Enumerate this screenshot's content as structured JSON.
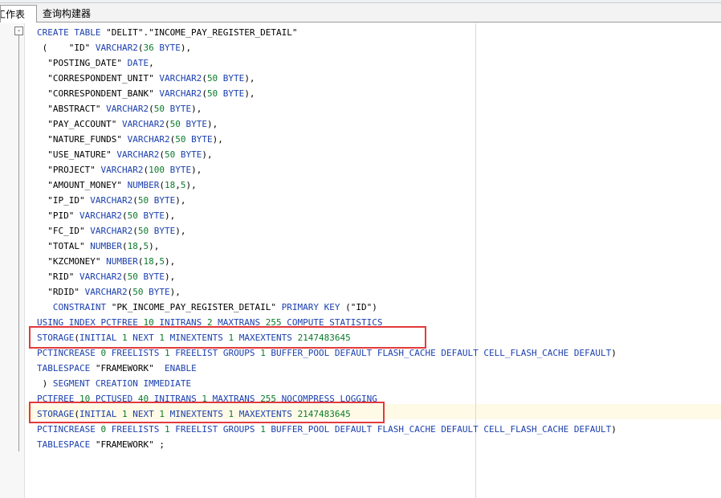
{
  "tabs": [
    {
      "label": "工作表"
    },
    {
      "label": "查询构建器"
    }
  ],
  "fold_symbol": "-",
  "code_lines": [
    [
      {
        "t": "CREATE TABLE ",
        "c": "kw"
      },
      {
        "t": "\"DELIT\".\"INCOME_PAY_REGISTER_DETAIL\"",
        "c": "str"
      }
    ],
    [
      {
        "t": " (    ",
        "c": "str"
      },
      {
        "t": "\"ID\" ",
        "c": "str"
      },
      {
        "t": "VARCHAR2",
        "c": "kw"
      },
      {
        "t": "(",
        "c": "str"
      },
      {
        "t": "36",
        "c": "num"
      },
      {
        "t": " BYTE",
        "c": "kw"
      },
      {
        "t": "),",
        "c": "str"
      }
    ],
    [
      {
        "t": "  \"POSTING_DATE\" ",
        "c": "str"
      },
      {
        "t": "DATE",
        "c": "kw"
      },
      {
        "t": ",",
        "c": "str"
      }
    ],
    [
      {
        "t": "  \"CORRESPONDENT_UNIT\" ",
        "c": "str"
      },
      {
        "t": "VARCHAR2",
        "c": "kw"
      },
      {
        "t": "(",
        "c": "str"
      },
      {
        "t": "50",
        "c": "num"
      },
      {
        "t": " BYTE",
        "c": "kw"
      },
      {
        "t": "),",
        "c": "str"
      }
    ],
    [
      {
        "t": "  \"CORRESPONDENT_BANK\" ",
        "c": "str"
      },
      {
        "t": "VARCHAR2",
        "c": "kw"
      },
      {
        "t": "(",
        "c": "str"
      },
      {
        "t": "50",
        "c": "num"
      },
      {
        "t": " BYTE",
        "c": "kw"
      },
      {
        "t": "),",
        "c": "str"
      }
    ],
    [
      {
        "t": "  \"ABSTRACT\" ",
        "c": "str"
      },
      {
        "t": "VARCHAR2",
        "c": "kw"
      },
      {
        "t": "(",
        "c": "str"
      },
      {
        "t": "50",
        "c": "num"
      },
      {
        "t": " BYTE",
        "c": "kw"
      },
      {
        "t": "),",
        "c": "str"
      }
    ],
    [
      {
        "t": "  \"PAY_ACCOUNT\" ",
        "c": "str"
      },
      {
        "t": "VARCHAR2",
        "c": "kw"
      },
      {
        "t": "(",
        "c": "str"
      },
      {
        "t": "50",
        "c": "num"
      },
      {
        "t": " BYTE",
        "c": "kw"
      },
      {
        "t": "),",
        "c": "str"
      }
    ],
    [
      {
        "t": "  \"NATURE_FUNDS\" ",
        "c": "str"
      },
      {
        "t": "VARCHAR2",
        "c": "kw"
      },
      {
        "t": "(",
        "c": "str"
      },
      {
        "t": "50",
        "c": "num"
      },
      {
        "t": " BYTE",
        "c": "kw"
      },
      {
        "t": "),",
        "c": "str"
      }
    ],
    [
      {
        "t": "  \"USE_NATURE\" ",
        "c": "str"
      },
      {
        "t": "VARCHAR2",
        "c": "kw"
      },
      {
        "t": "(",
        "c": "str"
      },
      {
        "t": "50",
        "c": "num"
      },
      {
        "t": " BYTE",
        "c": "kw"
      },
      {
        "t": "),",
        "c": "str"
      }
    ],
    [
      {
        "t": "  \"PROJECT\" ",
        "c": "str"
      },
      {
        "t": "VARCHAR2",
        "c": "kw"
      },
      {
        "t": "(",
        "c": "str"
      },
      {
        "t": "100",
        "c": "num"
      },
      {
        "t": " BYTE",
        "c": "kw"
      },
      {
        "t": "),",
        "c": "str"
      }
    ],
    [
      {
        "t": "  \"AMOUNT_MONEY\" ",
        "c": "str"
      },
      {
        "t": "NUMBER",
        "c": "kw"
      },
      {
        "t": "(",
        "c": "str"
      },
      {
        "t": "18",
        "c": "num"
      },
      {
        "t": ",",
        "c": "str"
      },
      {
        "t": "5",
        "c": "num"
      },
      {
        "t": "),",
        "c": "str"
      }
    ],
    [
      {
        "t": "  \"IP_ID\" ",
        "c": "str"
      },
      {
        "t": "VARCHAR2",
        "c": "kw"
      },
      {
        "t": "(",
        "c": "str"
      },
      {
        "t": "50",
        "c": "num"
      },
      {
        "t": " BYTE",
        "c": "kw"
      },
      {
        "t": "),",
        "c": "str"
      }
    ],
    [
      {
        "t": "  \"PID\" ",
        "c": "str"
      },
      {
        "t": "VARCHAR2",
        "c": "kw"
      },
      {
        "t": "(",
        "c": "str"
      },
      {
        "t": "50",
        "c": "num"
      },
      {
        "t": " BYTE",
        "c": "kw"
      },
      {
        "t": "),",
        "c": "str"
      }
    ],
    [
      {
        "t": "  \"FC_ID\" ",
        "c": "str"
      },
      {
        "t": "VARCHAR2",
        "c": "kw"
      },
      {
        "t": "(",
        "c": "str"
      },
      {
        "t": "50",
        "c": "num"
      },
      {
        "t": " BYTE",
        "c": "kw"
      },
      {
        "t": "),",
        "c": "str"
      }
    ],
    [
      {
        "t": "  \"TOTAL\" ",
        "c": "str"
      },
      {
        "t": "NUMBER",
        "c": "kw"
      },
      {
        "t": "(",
        "c": "str"
      },
      {
        "t": "18",
        "c": "num"
      },
      {
        "t": ",",
        "c": "str"
      },
      {
        "t": "5",
        "c": "num"
      },
      {
        "t": "),",
        "c": "str"
      }
    ],
    [
      {
        "t": "  \"KZCMONEY\" ",
        "c": "str"
      },
      {
        "t": "NUMBER",
        "c": "kw"
      },
      {
        "t": "(",
        "c": "str"
      },
      {
        "t": "18",
        "c": "num"
      },
      {
        "t": ",",
        "c": "str"
      },
      {
        "t": "5",
        "c": "num"
      },
      {
        "t": "),",
        "c": "str"
      }
    ],
    [
      {
        "t": "  \"RID\" ",
        "c": "str"
      },
      {
        "t": "VARCHAR2",
        "c": "kw"
      },
      {
        "t": "(",
        "c": "str"
      },
      {
        "t": "50",
        "c": "num"
      },
      {
        "t": " BYTE",
        "c": "kw"
      },
      {
        "t": "),",
        "c": "str"
      }
    ],
    [
      {
        "t": "  \"RDID\" ",
        "c": "str"
      },
      {
        "t": "VARCHAR2",
        "c": "kw"
      },
      {
        "t": "(",
        "c": "str"
      },
      {
        "t": "50",
        "c": "num"
      },
      {
        "t": " BYTE",
        "c": "kw"
      },
      {
        "t": "),",
        "c": "str"
      }
    ],
    [
      {
        "t": "   CONSTRAINT ",
        "c": "kw"
      },
      {
        "t": "\"PK_INCOME_PAY_REGISTER_DETAIL\" ",
        "c": "str"
      },
      {
        "t": "PRIMARY KEY ",
        "c": "kw"
      },
      {
        "t": "(\"ID\")",
        "c": "str"
      }
    ],
    [
      {
        "t": "USING INDEX PCTFREE ",
        "c": "kw"
      },
      {
        "t": "10",
        "c": "num"
      },
      {
        "t": " INITRANS ",
        "c": "kw"
      },
      {
        "t": "2",
        "c": "num"
      },
      {
        "t": " MAXTRANS ",
        "c": "kw"
      },
      {
        "t": "255",
        "c": "num"
      },
      {
        "t": " COMPUTE STATISTICS",
        "c": "kw"
      }
    ],
    [
      {
        "t": "STORAGE",
        "c": "kw"
      },
      {
        "t": "(",
        "c": "str"
      },
      {
        "t": "INITIAL ",
        "c": "kw"
      },
      {
        "t": "1",
        "c": "num"
      },
      {
        "t": " NEXT ",
        "c": "kw"
      },
      {
        "t": "1",
        "c": "num"
      },
      {
        "t": " MINEXTENTS ",
        "c": "kw"
      },
      {
        "t": "1",
        "c": "num"
      },
      {
        "t": " MAXEXTENTS ",
        "c": "kw"
      },
      {
        "t": "2147483645",
        "c": "num"
      }
    ],
    [
      {
        "t": "PCTINCREASE ",
        "c": "kw"
      },
      {
        "t": "0",
        "c": "num"
      },
      {
        "t": " FREELISTS ",
        "c": "kw"
      },
      {
        "t": "1",
        "c": "num"
      },
      {
        "t": " FREELIST GROUPS ",
        "c": "kw"
      },
      {
        "t": "1",
        "c": "num"
      },
      {
        "t": " BUFFER_POOL DEFAULT FLASH_CACHE DEFAULT CELL_FLASH_CACHE DEFAULT",
        "c": "kw"
      },
      {
        "t": ")",
        "c": "str"
      }
    ],
    [
      {
        "t": "TABLESPACE ",
        "c": "kw"
      },
      {
        "t": "\"FRAMEWORK\"  ",
        "c": "str"
      },
      {
        "t": "ENABLE",
        "c": "kw"
      }
    ],
    [
      {
        "t": " ) ",
        "c": "str"
      },
      {
        "t": "SEGMENT CREATION IMMEDIATE",
        "c": "kw"
      }
    ],
    [
      {
        "t": "PCTFREE ",
        "c": "kw"
      },
      {
        "t": "10",
        "c": "num"
      },
      {
        "t": " PCTUSED ",
        "c": "kw"
      },
      {
        "t": "40",
        "c": "num"
      },
      {
        "t": " INITRANS ",
        "c": "kw"
      },
      {
        "t": "1",
        "c": "num"
      },
      {
        "t": " MAXTRANS ",
        "c": "kw"
      },
      {
        "t": "255",
        "c": "num"
      },
      {
        "t": " NOCOMPRESS LOGGING",
        "c": "kw"
      }
    ],
    [
      {
        "t": "STORAGE",
        "c": "kw"
      },
      {
        "t": "(",
        "c": "str"
      },
      {
        "t": "INITIAL ",
        "c": "kw"
      },
      {
        "t": "1",
        "c": "num"
      },
      {
        "t": " NEXT ",
        "c": "kw"
      },
      {
        "t": "1",
        "c": "num"
      },
      {
        "t": " MINEXTENTS ",
        "c": "kw"
      },
      {
        "t": "1",
        "c": "num"
      },
      {
        "t": " MAXEXTENTS ",
        "c": "kw"
      },
      {
        "t": "2147483645",
        "c": "num"
      }
    ],
    [
      {
        "t": "PCTINCREASE ",
        "c": "kw"
      },
      {
        "t": "0",
        "c": "num"
      },
      {
        "t": " FREELISTS ",
        "c": "kw"
      },
      {
        "t": "1",
        "c": "num"
      },
      {
        "t": " FREELIST GROUPS ",
        "c": "kw"
      },
      {
        "t": "1",
        "c": "num"
      },
      {
        "t": " BUFFER_POOL DEFAULT FLASH_CACHE DEFAULT CELL_FLASH_CACHE DEFAULT",
        "c": "kw"
      },
      {
        "t": ")",
        "c": "str"
      }
    ],
    [
      {
        "t": "TABLESPACE ",
        "c": "kw"
      },
      {
        "t": "\"FRAMEWORK\" ",
        "c": "str"
      },
      {
        "t": ";",
        "c": "str"
      }
    ]
  ],
  "colors": {
    "keyword": "#1a3fae",
    "number": "#0a7a2a",
    "text": "#000000",
    "annotation_box": "#e33a3a",
    "current_line": "#fffae6"
  },
  "highlighted_line_index": 25,
  "annotated_line_indices": [
    20,
    25
  ]
}
